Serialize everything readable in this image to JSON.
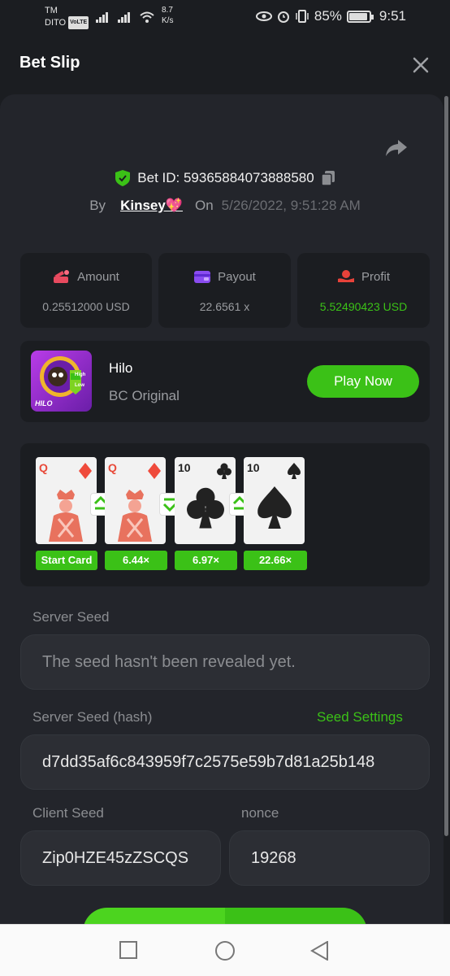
{
  "status_bar": {
    "carrier_line1": "TM",
    "carrier_line2": "DITO",
    "volte": "VoLTE",
    "speed_value": "8.7",
    "speed_unit": "K/s",
    "battery": "85%",
    "time": "9:51"
  },
  "header": {
    "title": "Bet Slip"
  },
  "bet": {
    "id_label": "Bet ID: 59365884073888580",
    "by_label": "By",
    "user": "Kinsey💖",
    "on_label": "On",
    "date": "5/26/2022, 9:51:28 AM"
  },
  "stats": {
    "amount": {
      "label": "Amount",
      "value": "0.25512000 USD"
    },
    "payout": {
      "label": "Payout",
      "value": "22.6561 x"
    },
    "profit": {
      "label": "Profit",
      "value": "5.52490423 USD"
    }
  },
  "game": {
    "name": "Hilo",
    "subtitle": "BC Original",
    "logo_text": "HILO",
    "logo_high": "High",
    "logo_low": "Low",
    "play_label": "Play Now"
  },
  "cards": [
    {
      "rank": "Q",
      "suit": "diamonds",
      "multiplier": "Start Card"
    },
    {
      "rank": "Q",
      "suit": "diamonds",
      "multiplier": "6.44×"
    },
    {
      "rank": "10",
      "suit": "clubs",
      "multiplier": "6.97×"
    },
    {
      "rank": "10",
      "suit": "spades",
      "multiplier": "22.66×"
    }
  ],
  "guesses": [
    "higher-or-same",
    "lower-or-same",
    "higher-or-same"
  ],
  "seeds": {
    "server_seed_label": "Server Seed",
    "server_seed_value": "The seed hasn't been revealed yet.",
    "server_hash_label": "Server Seed (hash)",
    "seed_settings_label": "Seed Settings",
    "server_hash_value": "d7dd35af6c843959f7c2575e59b7d81a25b148",
    "client_seed_label": "Client Seed",
    "client_seed_value": "Zip0HZE45zZSCQS",
    "nonce_label": "nonce",
    "nonce_value": "19268"
  },
  "colors": {
    "accent_green": "#3bc117",
    "background": "#1b1d21",
    "panel": "#23252b"
  }
}
